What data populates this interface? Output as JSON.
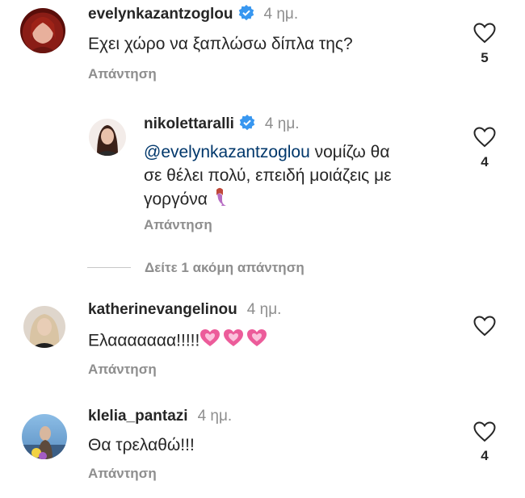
{
  "comments": [
    {
      "username": "evelynkazantzoglou",
      "verified": true,
      "time": "4 ημ.",
      "text": "Εχει χώρο να ξαπλώσω δίπλα της?",
      "reply_label": "Απάντηση",
      "likes": "5"
    },
    {
      "username": "nikolettaralli",
      "verified": true,
      "time": "4 ημ.",
      "mention": "@evelynkazantzoglou",
      "text_line1": " νομίζω θα",
      "text_line2": "σε θέλει πολύ, επειδή μοιάζεις με",
      "text_line3": "γοργόνα ",
      "emoji": "mermaid-emoji",
      "reply_label": "Απάντηση",
      "likes": "4"
    },
    {
      "view_more_label": "Δείτε 1 ακόμη απάντηση"
    },
    {
      "username": "katherinevangelinou",
      "verified": false,
      "time": "4 ημ.",
      "text": "Ελααααααα!!!!!",
      "emoji": "pink-hearts-emoji",
      "reply_label": "Απάντηση"
    },
    {
      "username": "klelia_pantazi",
      "verified": false,
      "time": "4 ημ.",
      "text": "Θα τρελαθώ!!!",
      "reply_label": "Απάντηση",
      "likes": "4"
    }
  ],
  "colors": {
    "verified": "#3897f0",
    "text": "#262626",
    "muted": "#8e8e8e",
    "mention": "#00376b",
    "heart_emoji": "#ec5c9a"
  }
}
